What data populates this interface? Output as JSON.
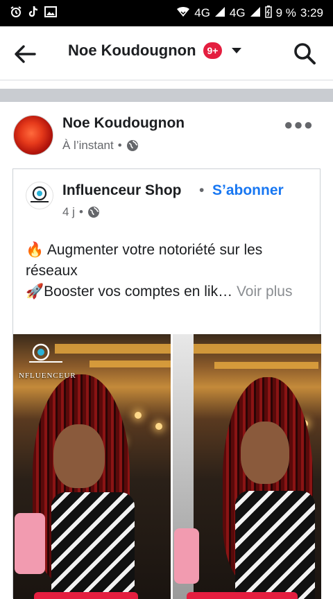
{
  "status_bar": {
    "network_1": "4G",
    "network_2": "4G",
    "battery": "9 %",
    "time": "3:29"
  },
  "app_bar": {
    "title": "Noe Koudougnon",
    "notification_count": "9+"
  },
  "post": {
    "author": "Noe Koudougnon",
    "time": "À l’instant",
    "separator": "•"
  },
  "shared": {
    "page_name": "Influenceur Shop",
    "separator": "•",
    "subscribe": "S’abonner",
    "time": "4 j",
    "text_line1": "🔥 Augmenter votre notoriété sur les réseaux",
    "text_line2": "🚀Booster vos comptes en lik…",
    "see_more": "Voir plus",
    "watermark": "NFLUENCEUR"
  },
  "icons": {
    "back": "arrow-left-icon",
    "search": "search-icon",
    "more": "more-icon",
    "privacy": "globe-icon"
  },
  "colors": {
    "accent": "#1877f2",
    "badge": "#e41e3f"
  }
}
